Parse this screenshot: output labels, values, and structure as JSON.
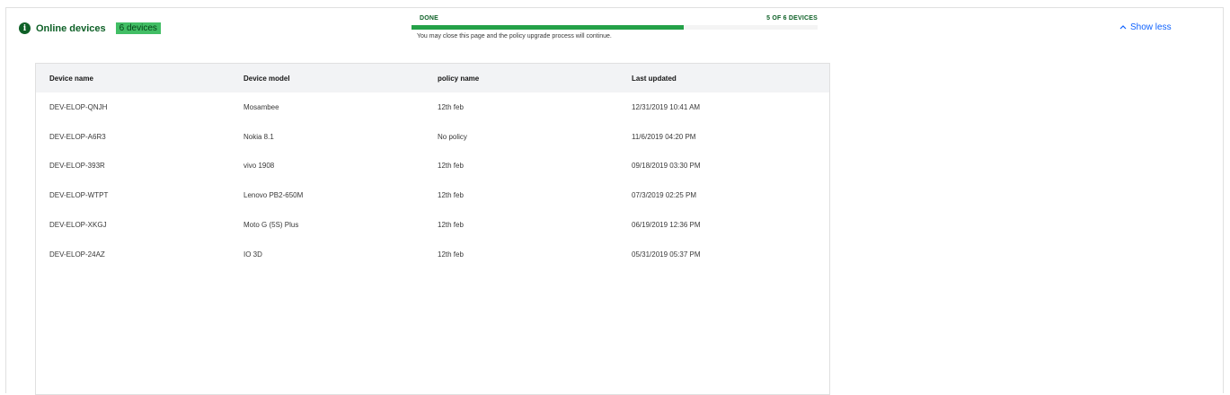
{
  "status": {
    "icon": "info-icon",
    "label": "Online devices",
    "badge": "6 devices"
  },
  "progress": {
    "state": "DONE",
    "count_label": "5 OF 6 DEVICES",
    "percent": 67,
    "note": "You may close this page and the policy upgrade process will continue."
  },
  "toggle": {
    "icon": "chevron-up-icon",
    "label": "Show less"
  },
  "table": {
    "columns": [
      "Device name",
      "Device model",
      "policy name",
      "Last updated"
    ],
    "rows": [
      [
        "DEV-ELOP-QNJH",
        "Mosambee",
        "12th feb",
        "12/31/2019 10:41 AM"
      ],
      [
        "DEV-ELOP-A6R3",
        "Nokia 8.1",
        "No policy",
        "11/6/2019 04:20 PM"
      ],
      [
        "DEV-ELOP-393R",
        "vivo 1908",
        "12th feb",
        "09/18/2019 03:30 PM"
      ],
      [
        "DEV-ELOP-WTPT",
        "Lenovo PB2-650M",
        "12th feb",
        "07/3/2019 02:25 PM"
      ],
      [
        "DEV-ELOP-XKGJ",
        "Moto G (5S) Plus",
        "12th feb",
        "06/19/2019 12:36 PM"
      ],
      [
        "DEV-ELOP-24AZ",
        "IO 3D",
        "12th feb",
        "05/31/2019 05:37 PM"
      ]
    ]
  }
}
